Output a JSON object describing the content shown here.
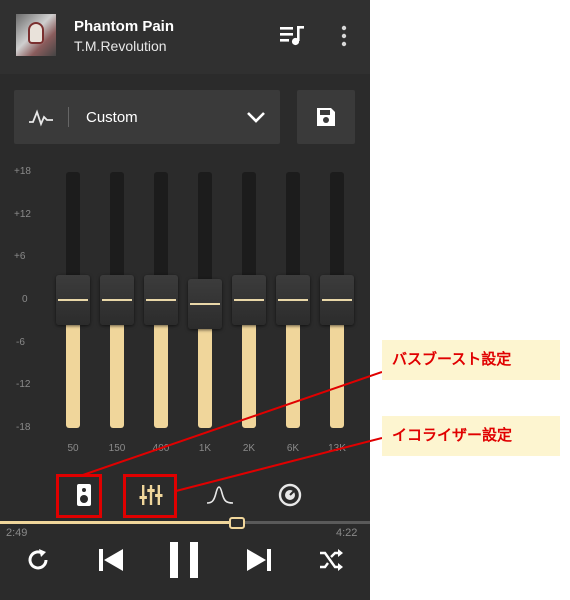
{
  "header": {
    "song_title": "Phantom Pain",
    "artist": "T.M.Revolution",
    "icons": [
      "album-art",
      "queue-music-icon",
      "more-vert-icon"
    ]
  },
  "preset": {
    "label": "Custom",
    "icons": [
      "eq-wave-icon",
      "chevron-down-icon",
      "save-icon"
    ]
  },
  "eq": {
    "db_labels": [
      "+18",
      "+12",
      "+6",
      "0",
      "-6",
      "-12",
      "-18"
    ],
    "bands": [
      {
        "freq": "50",
        "gain_db": 0
      },
      {
        "freq": "150",
        "gain_db": 0
      },
      {
        "freq": "400",
        "gain_db": 0
      },
      {
        "freq": "1K",
        "gain_db": -0.5
      },
      {
        "freq": "2K",
        "gain_db": 0
      },
      {
        "freq": "6K",
        "gain_db": 0
      },
      {
        "freq": "13K",
        "gain_db": 0
      }
    ],
    "range_db": [
      -18,
      18
    ],
    "accent": "#f0d69b"
  },
  "tabs": [
    "speaker-icon",
    "equalizer-sliders-icon",
    "wave-icon",
    "knob-icon"
  ],
  "playback": {
    "elapsed": "2:49",
    "total": "4:22",
    "progress": 0.64,
    "icons": [
      "repeat-icon",
      "previous-icon",
      "pause-icon",
      "next-icon",
      "shuffle-icon"
    ]
  },
  "annotations": {
    "bass_boost": "バスブースト設定",
    "equalizer": "イコライザー設定",
    "color": "#e00000"
  }
}
